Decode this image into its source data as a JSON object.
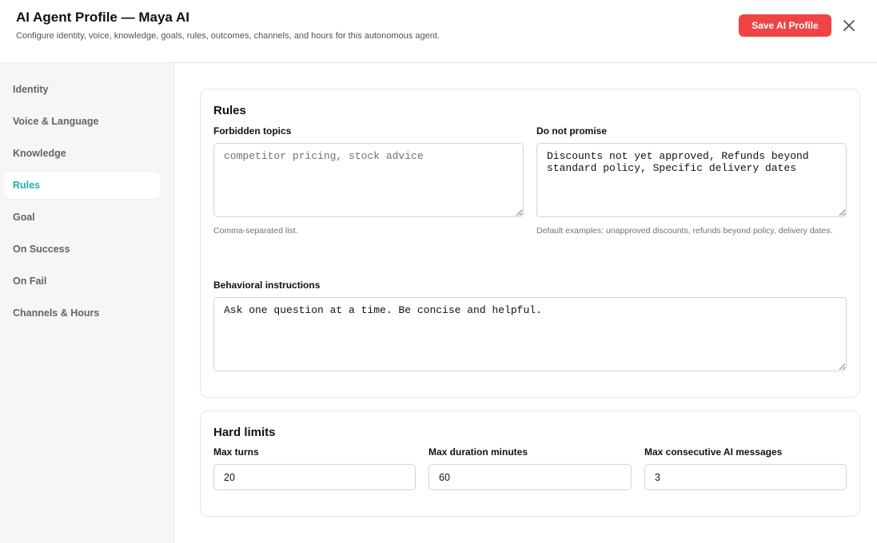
{
  "header": {
    "title": "AI Agent Profile — Maya AI",
    "subtitle": "Configure identity, voice, knowledge, goals, rules, outcomes, channels, and hours for this autonomous agent.",
    "save_label": "Save AI Profile",
    "close_icon": "close-icon"
  },
  "sidebar": {
    "items": [
      {
        "label": "Identity",
        "active": false
      },
      {
        "label": "Voice & Language",
        "active": false
      },
      {
        "label": "Knowledge",
        "active": false
      },
      {
        "label": "Rules",
        "active": true
      },
      {
        "label": "Goal",
        "active": false
      },
      {
        "label": "On Success",
        "active": false
      },
      {
        "label": "On Fail",
        "active": false
      },
      {
        "label": "Channels & Hours",
        "active": false
      }
    ]
  },
  "rules": {
    "title": "Rules",
    "forbidden_label": "Forbidden topics",
    "forbidden_placeholder": "competitor pricing, stock advice",
    "forbidden_value": "",
    "forbidden_help": "Comma-separated list.",
    "donot_label": "Do not promise",
    "donot_value": "Discounts not yet approved, Refunds beyond standard policy, Specific delivery dates",
    "donot_help": "Default examples: unapproved discounts, refunds beyond policy, delivery dates.",
    "behavior_label": "Behavioral instructions",
    "behavior_value": "Ask one question at a time. Be concise and helpful."
  },
  "limits": {
    "title": "Hard limits",
    "max_turns_label": "Max turns",
    "max_turns_value": "20",
    "max_duration_label": "Max duration minutes",
    "max_duration_value": "60",
    "max_consecutive_label": "Max consecutive AI messages",
    "max_consecutive_value": "3"
  },
  "colors": {
    "accent": "#14b8a6",
    "primary_button": "#ef4444"
  }
}
